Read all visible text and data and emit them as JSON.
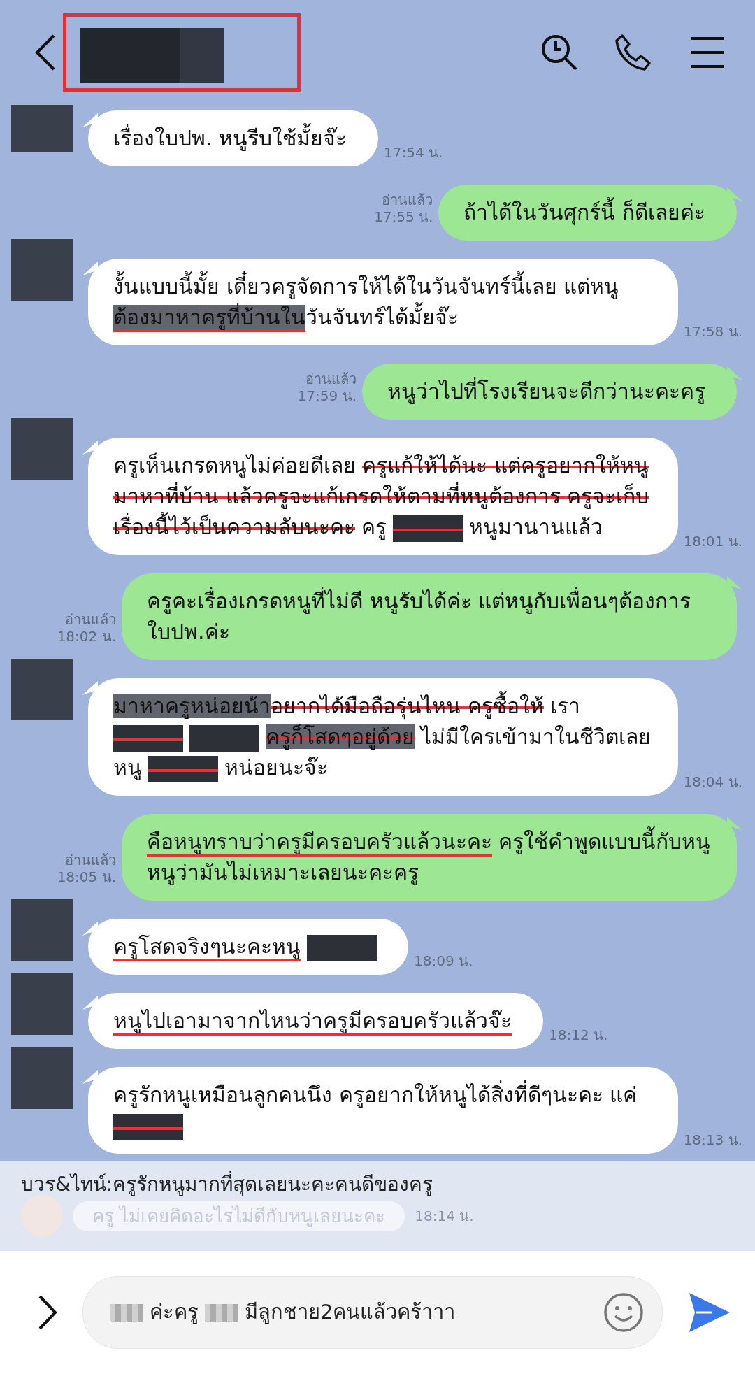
{
  "header": {
    "title": {
      "kind": "redacted"
    },
    "highlight_box": true
  },
  "messages": [
    {
      "kind": "in",
      "segments": [
        {
          "kind": "text",
          "text": "เรื่องใบปพ. หนูรีบใช้มั้ยจ๊ะ",
          "struck": false,
          "underlined": false
        }
      ],
      "time": "17:54 น."
    },
    {
      "kind": "out",
      "segments": [
        {
          "kind": "text",
          "text": "ถ้าได้ในวันศุกร์นี้ ก็ดีเลยค่ะ",
          "struck": false,
          "underlined": false
        }
      ],
      "read": "อ่านแล้ว",
      "time": "17:55 น."
    },
    {
      "kind": "in",
      "segments": [
        {
          "kind": "text",
          "text": "งั้นแบบนี้มั้ย เดี๋ยวครูจัดการให้ได้ในวันจันทร์นี้เลย แต่หนู",
          "struck": false,
          "underlined": false
        },
        {
          "kind": "highlight",
          "text": "ต้องมาหาครูที่บ้านใน",
          "struck": false,
          "underlined": true
        },
        {
          "kind": "text",
          "text": "วันจันทร์ได้มั้ยจ๊ะ",
          "struck": false,
          "underlined": false
        }
      ],
      "time": "17:58 น."
    },
    {
      "kind": "out",
      "segments": [
        {
          "kind": "text",
          "text": "หนูว่าไปที่โรงเรียนจะดีกว่านะคะครู",
          "struck": false,
          "underlined": false
        }
      ],
      "read": "อ่านแล้ว",
      "time": "17:59 น."
    },
    {
      "kind": "in",
      "segments": [
        {
          "kind": "text",
          "text": "ครูเห็นเกรดหนูไม่ค่อยดีเลย",
          "struck": false,
          "underlined": false
        },
        {
          "kind": "text",
          "text": "ครูแก้ให้ได้นะ แต่ครูอยากให้หนูมาหาที่บ้าน แล้วครูจะแก้เกรดให้ตามที่หนูต้องการ ครูจะเก็บเรื่องนี้ไว้เป็นความลับนะคะ",
          "struck": true,
          "underlined": false
        },
        {
          "kind": "text",
          "text": "ครู",
          "struck": false,
          "underlined": false
        },
        {
          "kind": "redacted",
          "struck": true,
          "underlined": false
        },
        {
          "kind": "text",
          "text": "หนูมานานแล้ว",
          "struck": false,
          "underlined": false
        }
      ],
      "time": "18:01 น."
    },
    {
      "kind": "out",
      "segments": [
        {
          "kind": "text",
          "text": "ครูคะเรื่องเกรดหนูที่ไม่ดี หนูรับได้ค่ะ แต่หนูกับเพื่อนๆต้องการใบปพ.ค่ะ",
          "struck": false,
          "underlined": false
        }
      ],
      "read": "อ่านแล้ว",
      "time": "18:02 น."
    },
    {
      "kind": "in",
      "segments": [
        {
          "kind": "highlight",
          "text": "มาหาครูหน่อยน้า",
          "struck": false,
          "underlined": false
        },
        {
          "kind": "text",
          "text": "อยากได้มือถือรุ่นไหน ครูซื้อให้",
          "struck": true,
          "underlined": false
        },
        {
          "kind": "text",
          "text": "เรา",
          "struck": false,
          "underlined": false
        },
        {
          "kind": "redacted",
          "struck": true,
          "underlined": false
        },
        {
          "kind": "redacted",
          "struck": false,
          "underlined": false
        },
        {
          "kind": "highlight",
          "text": "ครูก็โสดๆอยู่ด้วย",
          "struck": true,
          "underlined": false
        },
        {
          "kind": "text",
          "text": "ไม่มีใครเข้ามาในชีวิตเลย หนู",
          "struck": false,
          "underlined": false
        },
        {
          "kind": "redacted",
          "struck": true,
          "underlined": false
        },
        {
          "kind": "text",
          "text": "หน่อยนะจ๊ะ",
          "struck": false,
          "underlined": false
        }
      ],
      "time": "18:04 น."
    },
    {
      "kind": "out",
      "segments": [
        {
          "kind": "text",
          "text": "คือหนูทราบว่าครูมีครอบครัวแล้วนะคะ",
          "struck": false,
          "underlined": true
        },
        {
          "kind": "text",
          "text": "ครูใช้คำพูดแบบนี้กับหนู หนูว่ามันไม่เหมาะเลยนะคะครู",
          "struck": false,
          "underlined": false
        }
      ],
      "read": "อ่านแล้ว",
      "time": "18:05 น."
    },
    {
      "kind": "in",
      "segments": [
        {
          "kind": "text",
          "text": "ครูโสดจริงๆนะคะหนู",
          "struck": false,
          "underlined": true
        },
        {
          "kind": "redacted",
          "struck": false,
          "underlined": false
        }
      ],
      "time": "18:09 น."
    },
    {
      "kind": "in",
      "segments": [
        {
          "kind": "text",
          "text": "หนูไปเอามาจากไหนว่าครูมีครอบครัวแล้วจ๊ะ",
          "struck": false,
          "underlined": true
        }
      ],
      "time": "18:12 น."
    },
    {
      "kind": "in",
      "segments": [
        {
          "kind": "text",
          "text": "ครูรักหนูเหมือนลูกคนนึง ครูอยากให้หนูได้สิ่งที่ดีๆนะคะ แค่",
          "struck": false,
          "underlined": false
        },
        {
          "kind": "redacted",
          "struck": true,
          "underlined": false
        }
      ],
      "time": "18:13 น."
    }
  ],
  "notification": {
    "text": "บวร&ไทน์:ครูรักหนูมากที่สุดเลยนะคะคนดีของครู",
    "faded_message": "ครู ไม่เคยคิดอะไรไม่ดีกับหนูเลยนะคะ",
    "faded_time": "18:14 น."
  },
  "composer": {
    "segments": [
      {
        "kind": "pixelated"
      },
      {
        "kind": "text",
        "text": "ค่ะครู"
      },
      {
        "kind": "pixelated"
      },
      {
        "kind": "text",
        "text": "มีลูกชาย2คนแล้วคร้าาา"
      }
    ]
  }
}
